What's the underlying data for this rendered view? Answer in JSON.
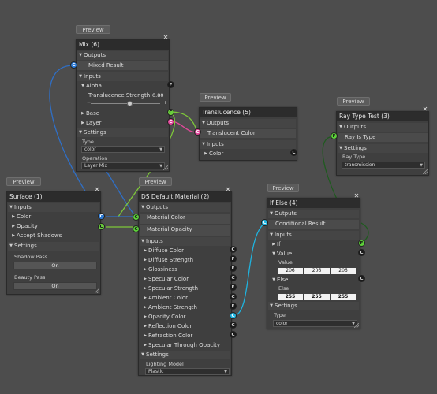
{
  "preview_label": "Preview",
  "mix": {
    "title": "Mix (6)",
    "outputs": "Outputs",
    "out_result": "Mixed Result",
    "inputs": "Inputs",
    "alpha": "Alpha",
    "translucence_strength": "Translucence Strength",
    "strength_value": "0.80",
    "base": "Base",
    "layer": "Layer",
    "settings": "Settings",
    "type_label": "Type",
    "type_value": "color",
    "operation_label": "Operation",
    "operation_value": "Layer Mix"
  },
  "translucence": {
    "title": "Translucence (5)",
    "outputs": "Outputs",
    "out_color": "Translucent Color",
    "inputs": "Inputs",
    "color": "Color"
  },
  "raytype": {
    "title": "Ray Type Test (3)",
    "outputs": "Outputs",
    "out_is_type": "Ray Is Type",
    "settings": "Settings",
    "ray_type_label": "Ray Type",
    "ray_type_value": "transmission"
  },
  "surface": {
    "title": "Surface (1)",
    "inputs": "Inputs",
    "color": "Color",
    "opacity": "Opacity",
    "accept_shadows": "Accept Shadows",
    "settings": "Settings",
    "shadow_pass": "Shadow Pass",
    "shadow_pass_btn": "On",
    "beauty_pass": "Beauty Pass",
    "beauty_pass_btn": "On"
  },
  "ds": {
    "title": "DS Default Material (2)",
    "outputs": "Outputs",
    "out_color": "Material Color",
    "out_opacity": "Material Opacity",
    "inputs": "Inputs",
    "items": [
      {
        "label": "Diffuse Color",
        "port": "C"
      },
      {
        "label": "Diffuse Strength",
        "port": "F"
      },
      {
        "label": "Glossiness",
        "port": "F"
      },
      {
        "label": "Specular Color",
        "port": "C"
      },
      {
        "label": "Specular Strength",
        "port": "F"
      },
      {
        "label": "Ambient Color",
        "port": "C"
      },
      {
        "label": "Ambient Strength",
        "port": "F"
      },
      {
        "label": "Opacity Color",
        "port": "C"
      },
      {
        "label": "Reflection Color",
        "port": "C"
      },
      {
        "label": "Refraction Color",
        "port": "C"
      },
      {
        "label": "Specular Through Opacity",
        "port": ""
      }
    ],
    "settings": "Settings",
    "lighting_label": "Lighting Model",
    "lighting_value": "Plastic"
  },
  "ifelse": {
    "title": "If Else (4)",
    "outputs": "Outputs",
    "out_result": "Conditional Result",
    "inputs": "Inputs",
    "if_label": "If",
    "value_label": "Value",
    "value_field_label": "Value",
    "value_rgb": [
      "206",
      "206",
      "206"
    ],
    "else_label": "Else",
    "else_field_label": "Else",
    "else_rgb": [
      "255",
      "255",
      "255"
    ],
    "settings": "Settings",
    "type_label": "Type",
    "type_value": "color"
  },
  "port_letters": {
    "c": "C",
    "f": "F"
  },
  "colors": {
    "background": "#4d4d4d",
    "node_body": "#3f3f3f",
    "title_bar": "#2c2c2c",
    "wire_blue": "#2f6fc6",
    "wire_pink": "#e0489a",
    "wire_green": "#1f5a1f",
    "wire_lime": "#7ec83a",
    "wire_cyan": "#1fb4e0"
  }
}
